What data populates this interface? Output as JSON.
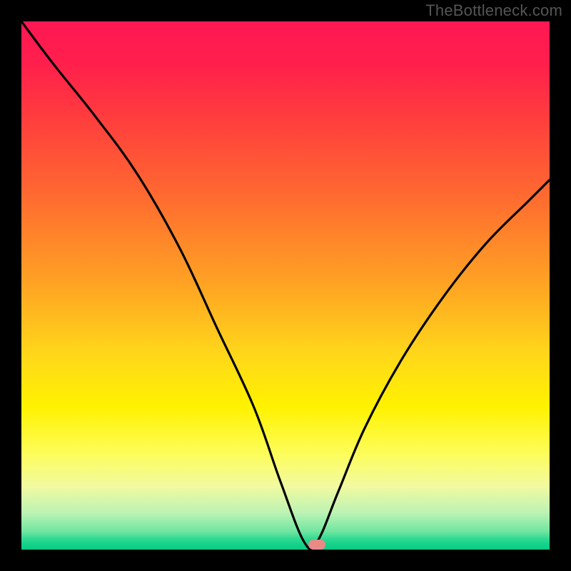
{
  "attribution": "TheBottleneck.com",
  "chart_data": {
    "type": "line",
    "title": "",
    "xlabel": "",
    "ylabel": "",
    "xlim": [
      0,
      100
    ],
    "ylim": [
      0,
      100
    ],
    "series": [
      {
        "name": "bottleneck-curve",
        "x": [
          0,
          6,
          14,
          22,
          30,
          37,
          44,
          49,
          53.5,
          56,
          60,
          65,
          72,
          80,
          88,
          96,
          100
        ],
        "values": [
          100,
          92,
          82,
          71,
          57,
          42,
          27,
          13,
          1.5,
          1.5,
          11,
          23,
          36,
          48,
          58,
          66,
          70
        ]
      }
    ],
    "annotations": [
      {
        "type": "marker",
        "x": 56,
        "y": 1,
        "label": "optimal-point"
      }
    ],
    "grid": false,
    "legend": false
  },
  "colors": {
    "marker": "#e88a86",
    "curve": "#000000"
  }
}
